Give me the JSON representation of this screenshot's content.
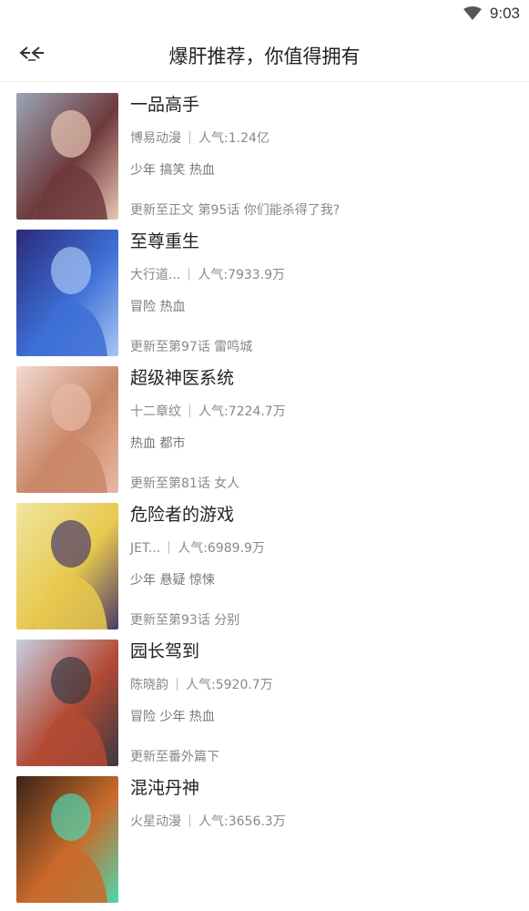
{
  "status_bar": {
    "time": "9:03"
  },
  "header": {
    "title": "爆肝推荐，你值得拥有"
  },
  "comics": [
    {
      "name": "一品高手",
      "author": "博易动漫",
      "popularity": "人气:1.24亿",
      "tags": "少年 搞笑 热血",
      "update": "更新至正文 第95话  你们能杀得了我?",
      "palette": [
        "#9aa6b6",
        "#6e3a3c",
        "#e9c6b4"
      ]
    },
    {
      "name": "至尊重生",
      "author": "大行道...",
      "popularity": "人气:7933.9万",
      "tags": "冒险 热血",
      "update": "更新至第97话 雷鸣城",
      "palette": [
        "#2a2a7a",
        "#3d6fd6",
        "#a8c6f2"
      ]
    },
    {
      "name": "超级神医系统",
      "author": "十二章纹",
      "popularity": "人气:7224.7万",
      "tags": "热血 都市",
      "update": "更新至第81话 女人",
      "palette": [
        "#f3d9d4",
        "#c98766",
        "#e7b9a6"
      ]
    },
    {
      "name": "危险者的游戏",
      "author": "JET...",
      "popularity": "人气:6989.9万",
      "tags": "少年 悬疑 惊悚",
      "update": "更新至第93话 分别",
      "palette": [
        "#f0e6a0",
        "#e8c84e",
        "#4a3a6a"
      ]
    },
    {
      "name": "园长驾到",
      "author": "陈晓韵",
      "popularity": "人气:5920.7万",
      "tags": "冒险 少年 热血",
      "update": "更新至番外篇下",
      "palette": [
        "#c7cfe3",
        "#b34a34",
        "#3a3a44"
      ]
    },
    {
      "name": "混沌丹神",
      "author": "火星动漫",
      "popularity": "人气:3656.3万",
      "tags": "",
      "update": "",
      "palette": [
        "#3a2418",
        "#c96a2a",
        "#4fd6b0"
      ]
    }
  ]
}
